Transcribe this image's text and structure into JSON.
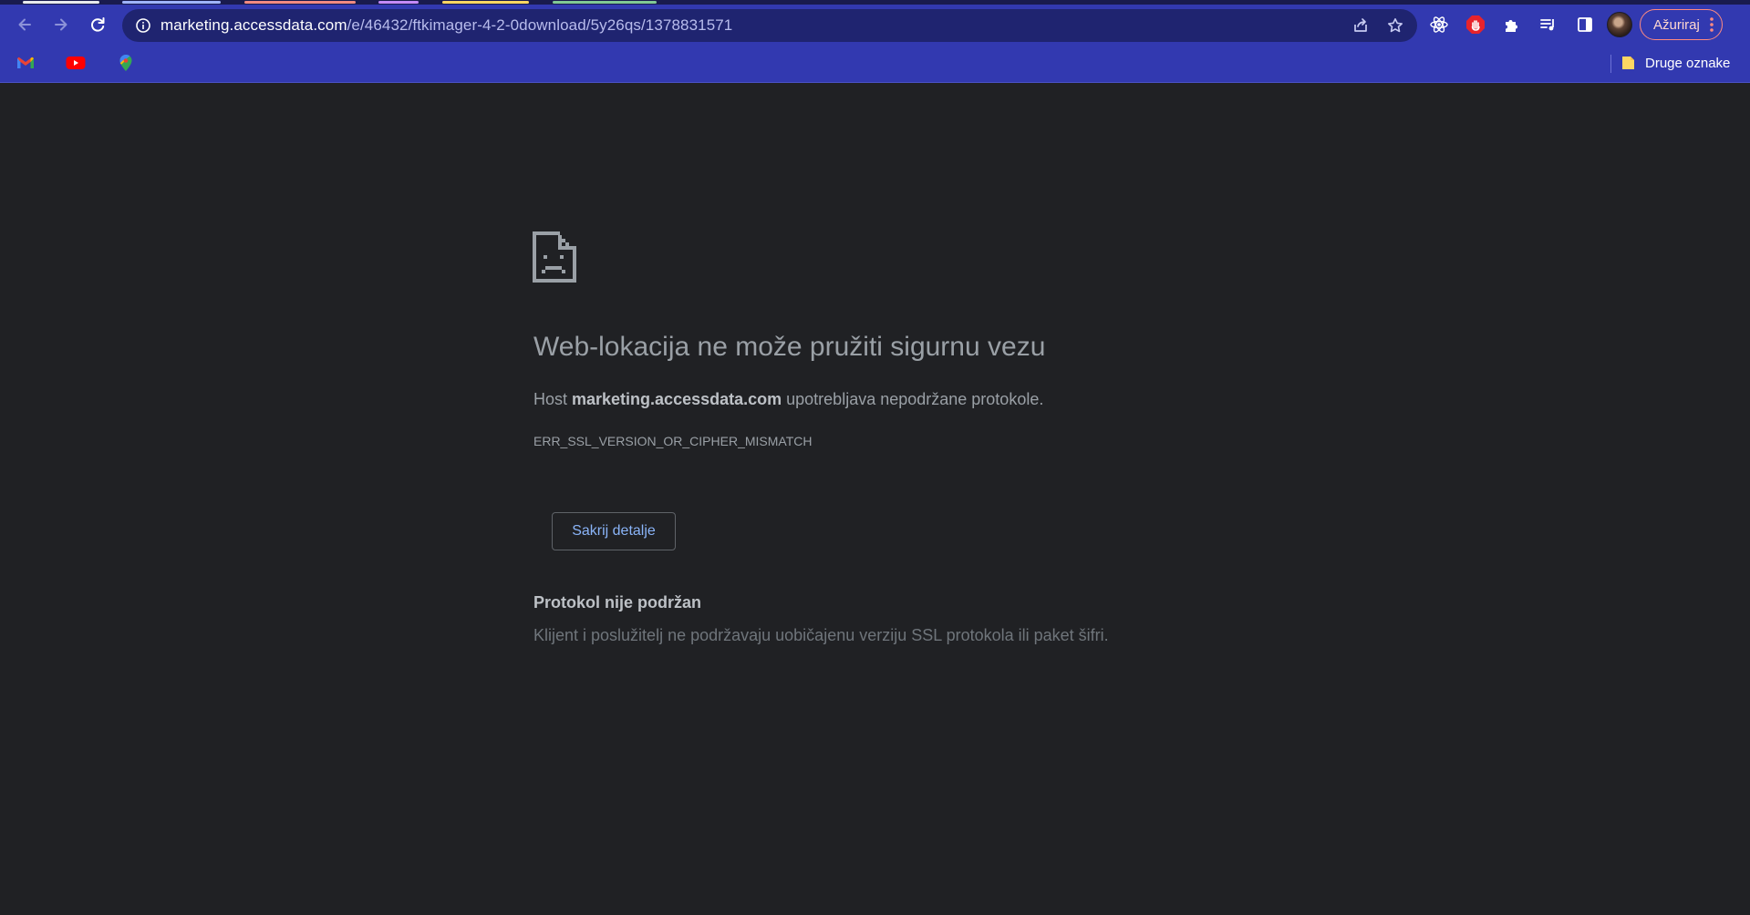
{
  "browser": {
    "tab_indicator_colors": [
      "#e8eaed",
      "#9fb4ff",
      "#f28b82",
      "#c58af9",
      "#fdd663",
      "#81c995"
    ],
    "url": {
      "host": "marketing.accessdata.com",
      "path": "/e/46432/ftkimager-4-2-0download/5y26qs/1378831571"
    },
    "icons": {
      "back": "arrow-left-icon",
      "forward": "arrow-right-icon",
      "reload": "reload-icon",
      "site_info": "info-icon",
      "share": "share-icon",
      "bookmark": "star-icon",
      "extensions": [
        "react-devtools-icon",
        "adblock-hand-icon",
        "puzzle-icon",
        "media-playlist-icon",
        "side-panel-icon"
      ],
      "menu": "kebab-menu-icon"
    },
    "update_button_label": "Ažuriraj",
    "accent_colors": {
      "chrome_bg": "#3239b0",
      "omnibox_bg": "#1f2470",
      "update_border": "#ff8a80"
    }
  },
  "bookmarks_bar": {
    "items": [
      {
        "name": "gmail",
        "icon": "gmail-icon"
      },
      {
        "name": "youtube",
        "icon": "youtube-icon"
      },
      {
        "name": "maps",
        "icon": "maps-pin-icon"
      }
    ],
    "other_bookmarks_label": "Druge oznake"
  },
  "error_page": {
    "icon": "sad-document-icon",
    "title": "Web-lokacija ne može pružiti sigurnu vezu",
    "message_prefix": "Host ",
    "message_host": "marketing.accessdata.com",
    "message_suffix": " upotrebljava nepodržane protokole.",
    "error_code": "ERR_SSL_VERSION_OR_CIPHER_MISMATCH",
    "details_button_label": "Sakrij detalje",
    "details_title": "Protokol nije podržan",
    "details_text": "Klijent i poslužitelj ne podržavaju uobičajenu verziju SSL protokola ili paket šifri."
  }
}
